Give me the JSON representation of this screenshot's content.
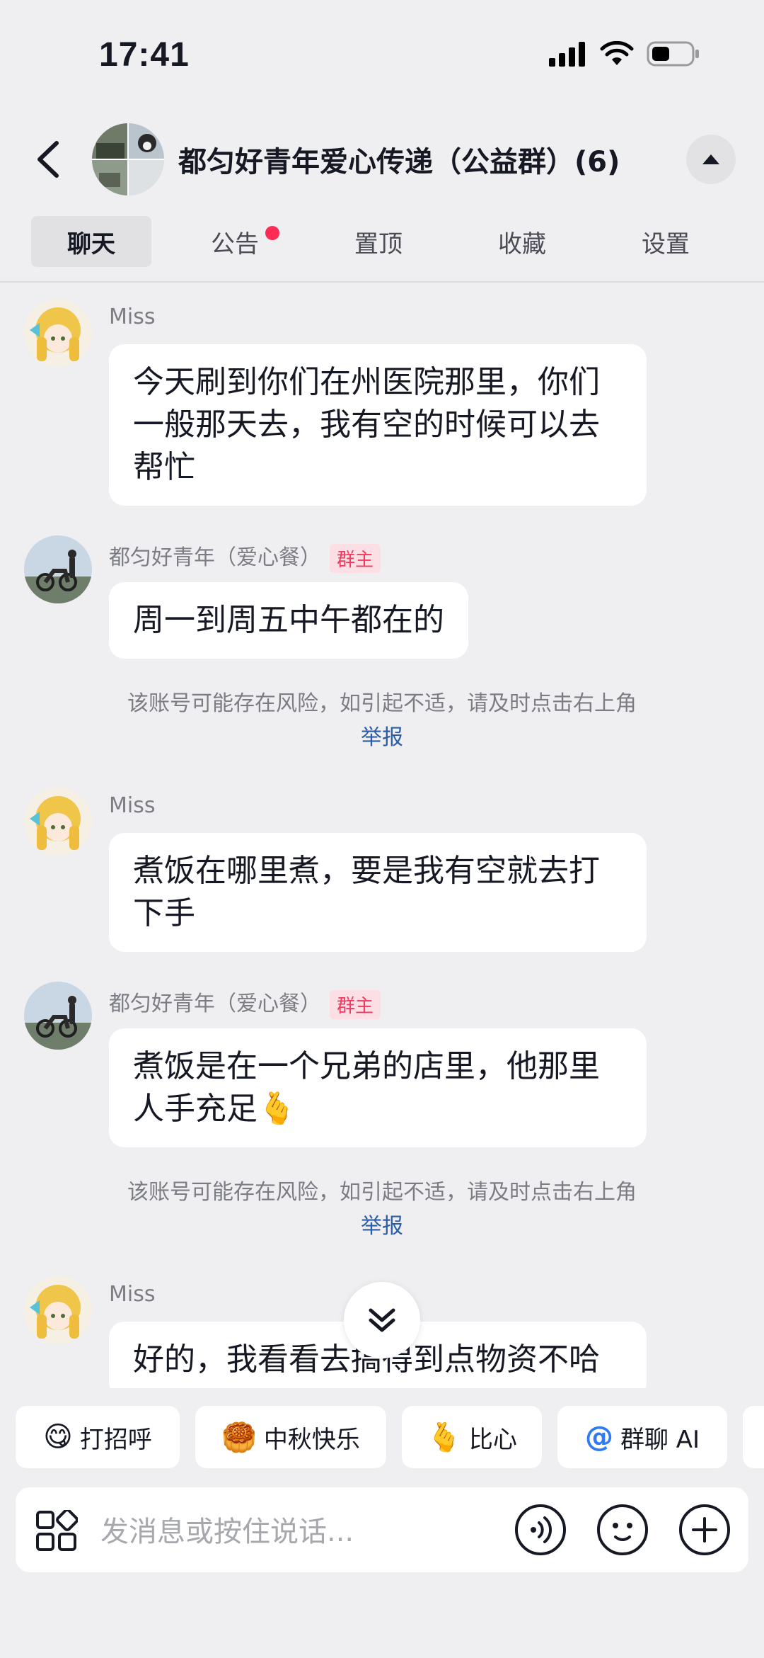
{
  "status_bar": {
    "time": "17:41"
  },
  "header": {
    "title": "都匀好青年爱心传递（公益群）(6)"
  },
  "tabs": [
    {
      "label": "聊天",
      "active": true
    },
    {
      "label": "公告",
      "has_dot": true
    },
    {
      "label": "置顶"
    },
    {
      "label": "收藏"
    },
    {
      "label": "设置"
    }
  ],
  "messages": [
    {
      "sender": "Miss",
      "text": "今天刷到你们在州医院那里，你们一般那天去，我有空的时候可以去帮忙"
    },
    {
      "sender": "都匀好青年（爱心餐）",
      "badge": "群主",
      "text": "周一到周五中午都在的"
    },
    {
      "sender": "Miss",
      "text": "煮饭在哪里煮，要是我有空就去打下手"
    },
    {
      "sender": "都匀好青年（爱心餐）",
      "badge": "群主",
      "text": "煮饭是在一个兄弟的店里，他那里人手充足🫰"
    },
    {
      "sender": "Miss",
      "text": "好的，我看看去搞得到点物资不哈"
    }
  ],
  "risk_notice": {
    "text": "该账号可能存在风险，如引起不适，请及时点击右上角",
    "link": "举报"
  },
  "quick_replies": [
    {
      "emoji": "😋",
      "label": "打招呼"
    },
    {
      "emoji": "🥮",
      "label": "中秋快乐"
    },
    {
      "emoji": "🫰",
      "label": "比心"
    },
    {
      "emoji": "@",
      "label": "群聊 AI"
    }
  ],
  "input": {
    "placeholder": "发消息或按住说话..."
  },
  "colors": {
    "accent_red": "#fe2c55",
    "link_blue": "#2b5da8",
    "background": "#efeff1"
  }
}
